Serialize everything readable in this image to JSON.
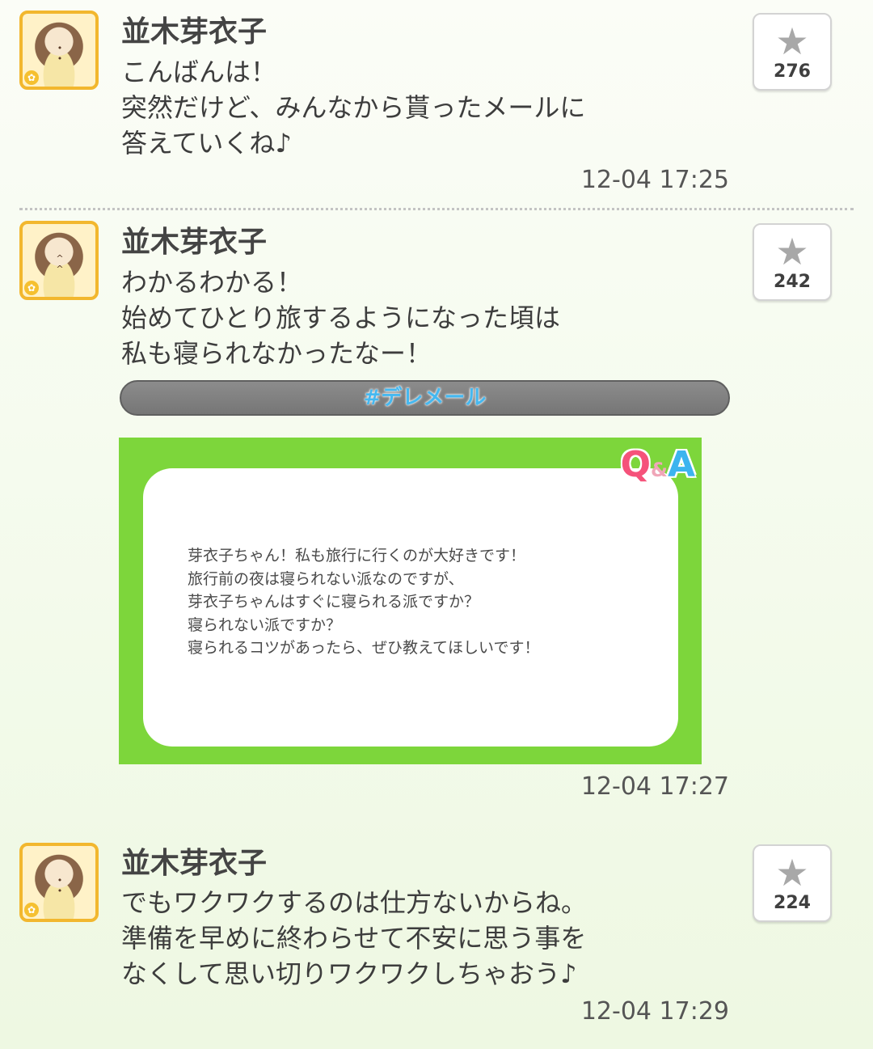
{
  "posts": [
    {
      "author": "並木芽衣子",
      "text": "こんばんは！\n突然だけど、みんなから貰ったメールに\n答えていくね♪",
      "timestamp": "12-04 17:25",
      "favorites": "276"
    },
    {
      "author": "並木芽衣子",
      "text": "わかるわかる！\n始めてひとり旅するようになった頃は\n私も寝られなかったなー！",
      "hashtag": "#デレメール",
      "qa_logo": {
        "q": "Q",
        "amp": "&",
        "a": "A"
      },
      "qa_text": "芽衣子ちゃん！私も旅行に行くのが大好きです！\n旅行前の夜は寝られない派なのですが、\n芽衣子ちゃんはすぐに寝られる派ですか？\n寝られない派ですか？\n寝られるコツがあったら、ぜひ教えてほしいです！",
      "timestamp": "12-04 17:27",
      "favorites": "242"
    },
    {
      "author": "並木芽衣子",
      "text": "でもワクワクするのは仕方ないからね。\n準備を早めに終わらせて不安に思う事を\nなくして思い切りワクワクしちゃおう♪",
      "timestamp": "12-04 17:29",
      "favorites": "224"
    }
  ],
  "icons": {
    "favorite": "star-icon",
    "badge": "flower-icon"
  },
  "colors": {
    "qa_green": "#7dd63b",
    "avatar_frame": "#f2b72e",
    "hashtag": "#45b8f0"
  }
}
